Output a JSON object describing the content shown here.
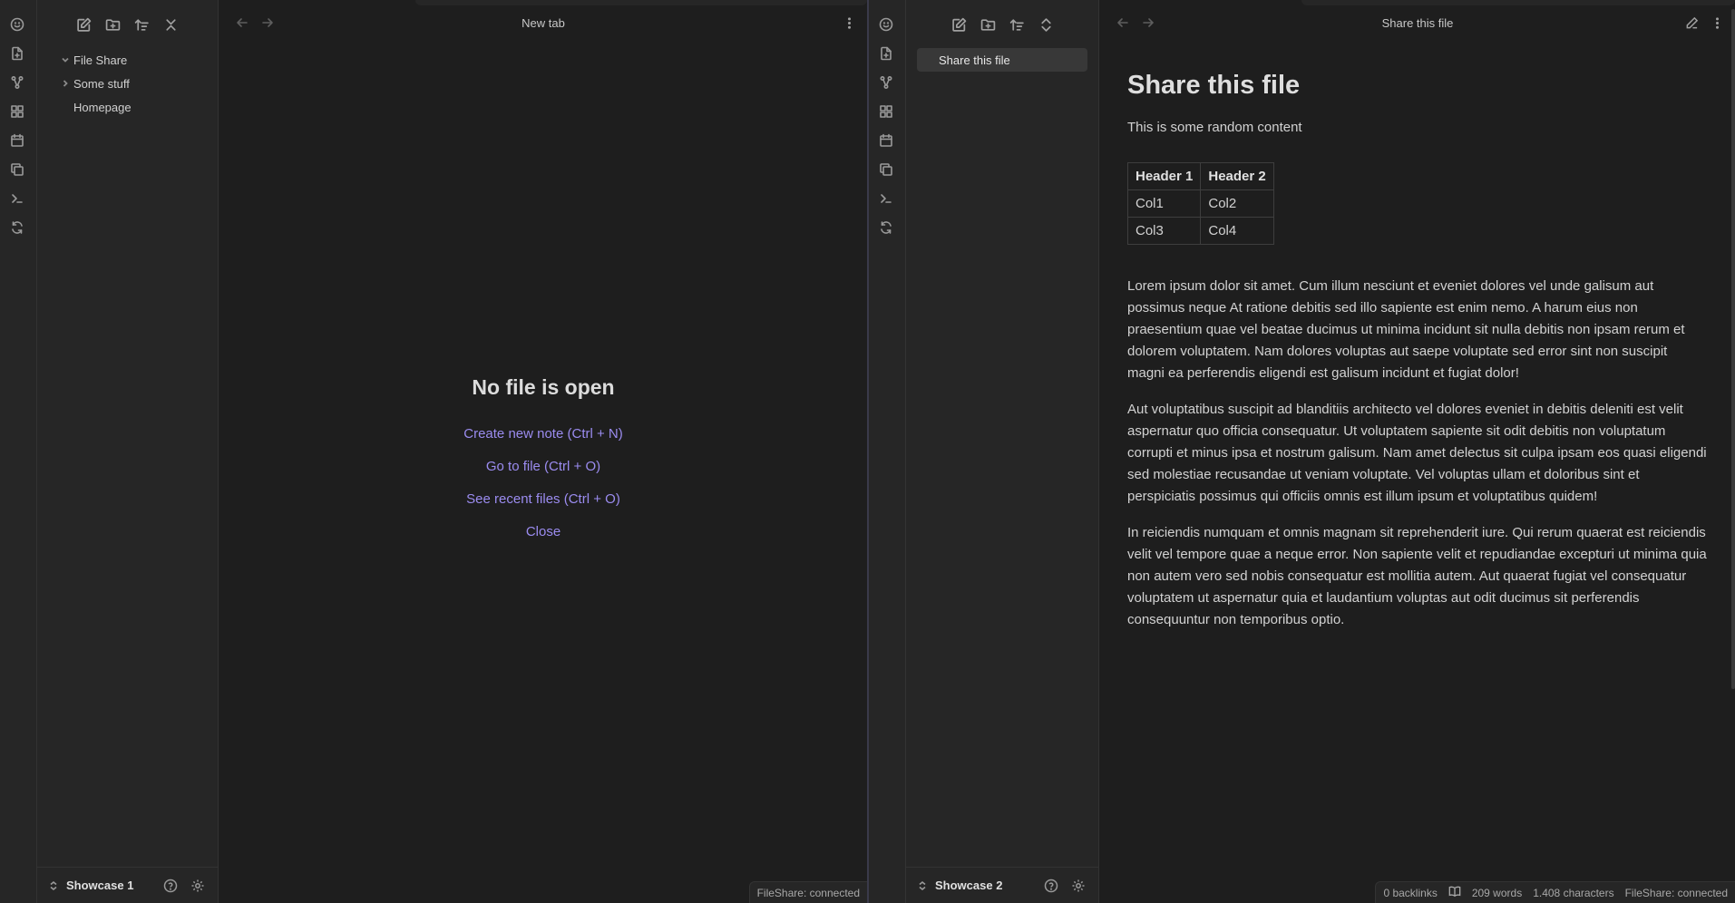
{
  "left": {
    "tree": [
      {
        "label": "File Share",
        "expanded": true
      },
      {
        "label": "Some stuff",
        "expanded": false
      },
      {
        "label": "Homepage"
      }
    ],
    "vault_name": "Showcase 1",
    "view_title": "New tab",
    "empty": {
      "title": "No file is open",
      "actions": [
        "Create new note (Ctrl + N)",
        "Go to file (Ctrl + O)",
        "See recent files (Ctrl + O)",
        "Close"
      ]
    },
    "status": "FileShare: connected"
  },
  "right": {
    "tree": [
      {
        "label": "Share this file",
        "active": true
      }
    ],
    "vault_name": "Showcase 2",
    "view_title": "Share this file",
    "note": {
      "title": "Share this file",
      "intro": "This is some random content",
      "table": {
        "headers": [
          "Header 1",
          "Header 2"
        ],
        "rows": [
          [
            "Col1",
            "Col2"
          ],
          [
            "Col3",
            "Col4"
          ]
        ]
      },
      "paragraphs": [
        "Lorem ipsum dolor sit amet. Cum illum nesciunt et eveniet dolores vel unde galisum aut possimus neque At ratione debitis sed illo sapiente est enim nemo. A harum eius non praesentium quae vel beatae ducimus ut minima incidunt sit nulla debitis non ipsam rerum et dolorem voluptatem. Nam dolores voluptas aut saepe voluptate sed error sint non suscipit magni ea perferendis eligendi est galisum incidunt et fugiat dolor!",
        "Aut voluptatibus suscipit ad blanditiis architecto vel dolores eveniet in debitis deleniti est velit aspernatur quo officia consequatur. Ut voluptatem sapiente sit odit debitis non voluptatum corrupti et minus ipsa et nostrum galisum. Nam amet delectus sit culpa ipsam eos quasi eligendi sed molestiae recusandae ut veniam voluptate. Vel voluptas ullam et doloribus sint et perspiciatis possimus qui officiis omnis est illum ipsum et voluptatibus quidem!",
        "In reiciendis numquam et omnis magnam sit reprehenderit iure. Qui rerum quaerat est reiciendis velit vel tempore quae a neque error. Non sapiente velit et repudiandae excepturi ut minima quia non autem vero sed nobis consequatur est mollitia autem. Aut quaerat fugiat vel consequatur voluptatem ut aspernatur quia et laudantium voluptas aut odit ducimus sit perferendis consequuntur non temporibus optio."
      ]
    },
    "status": {
      "backlinks": "0 backlinks",
      "words": "209 words",
      "characters": "1.408 characters",
      "plugin": "FileShare: connected"
    }
  },
  "colors": {
    "accent": "#9b8cf0",
    "background": "#1e1e1e",
    "sidebar": "#262626"
  }
}
